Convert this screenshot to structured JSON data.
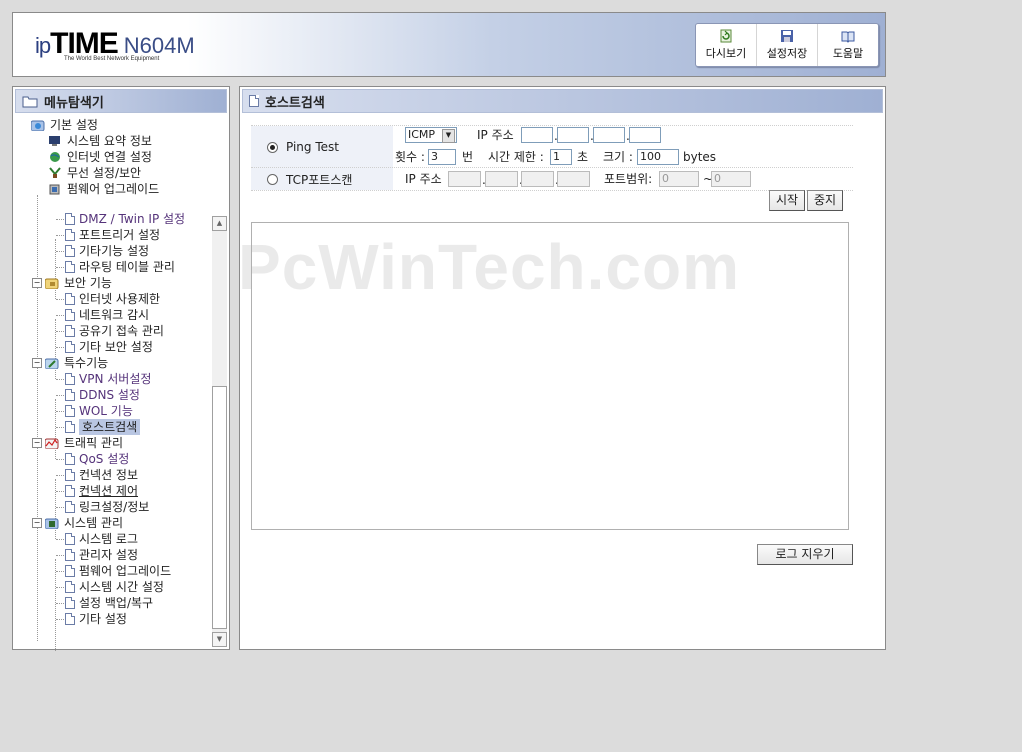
{
  "header": {
    "logo_ip": "ip",
    "logo_time": "TIME",
    "logo_model": "N604M",
    "logo_tagline": "The World Best Network Equipment",
    "buttons": [
      "다시보기",
      "설정저장",
      "도움말"
    ]
  },
  "sidebar": {
    "title": "메뉴탐색기",
    "items": [
      {
        "label": "기본 설정",
        "level": 0
      },
      {
        "label": "시스템 요약 정보",
        "level": 1
      },
      {
        "label": "인터넷 연결 설정",
        "level": 1
      },
      {
        "label": "무선 설정/보안",
        "level": 1
      },
      {
        "label": "펌웨어 업그레이드",
        "level": 1
      },
      {
        "label": "DMZ / Twin IP 설정",
        "level": 2
      },
      {
        "label": "포트트리거 설정",
        "level": 2
      },
      {
        "label": "기타기능 설정",
        "level": 2
      },
      {
        "label": "라우팅 테이블 관리",
        "level": 2
      },
      {
        "label": "보안 기능",
        "level": 0
      },
      {
        "label": "인터넷 사용제한",
        "level": 2
      },
      {
        "label": "네트워크 감시",
        "level": 2
      },
      {
        "label": "공유기 접속 관리",
        "level": 2
      },
      {
        "label": "기타 보안 설정",
        "level": 2
      },
      {
        "label": "특수기능",
        "level": 0
      },
      {
        "label": "VPN 서버설정",
        "level": 2
      },
      {
        "label": "DDNS 설정",
        "level": 2
      },
      {
        "label": "WOL 기능",
        "level": 2
      },
      {
        "label": "호스트검색",
        "level": 2,
        "selected": true
      },
      {
        "label": "트래픽 관리",
        "level": 0
      },
      {
        "label": "QoS 설정",
        "level": 2
      },
      {
        "label": "컨넥션 정보",
        "level": 2
      },
      {
        "label": "컨넥션 제어",
        "level": 2
      },
      {
        "label": "링크설정/정보",
        "level": 2
      },
      {
        "label": "시스템 관리",
        "level": 0
      },
      {
        "label": "시스템 로그",
        "level": 2
      },
      {
        "label": "관리자 설정",
        "level": 2
      },
      {
        "label": "펌웨어 업그레이드",
        "level": 2
      },
      {
        "label": "시스템 시간 설정",
        "level": 2
      },
      {
        "label": "설정 백업/복구",
        "level": 2
      },
      {
        "label": "기타 설정",
        "level": 2
      }
    ]
  },
  "main": {
    "title": "호스트검색",
    "ping": {
      "label": "Ping Test",
      "protocol": "ICMP",
      "ip_label": "IP 주소",
      "count_label": "횟수 :",
      "count_value": "3",
      "count_unit": "번",
      "timeout_label": "시간 제한 :",
      "timeout_value": "1",
      "timeout_unit": "초",
      "size_label": "크기 :",
      "size_value": "100",
      "size_unit": "bytes"
    },
    "tcp": {
      "label": "TCP포트스캔",
      "ip_label": "IP 주소",
      "port_label": "포트범위:",
      "port_from": "0",
      "port_sep": "~",
      "port_to": "0"
    },
    "start_button": "시작",
    "stop_button": "중지",
    "clear_log_button": "로그 지우기"
  },
  "watermark": "PcWinTech.com",
  "colors": {
    "panel_header": "#9fb0d3",
    "selected": "#b9c6e2",
    "link": "#55337a"
  }
}
